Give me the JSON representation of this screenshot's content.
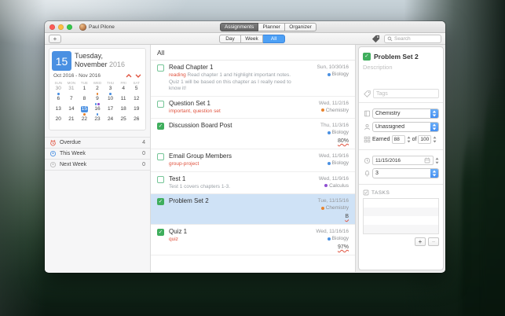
{
  "titlebar": {
    "user": "Paul Pilone",
    "tabs": [
      {
        "label": "Assignments",
        "active": true
      },
      {
        "label": "Planner",
        "active": false
      },
      {
        "label": "Organizer",
        "active": false
      }
    ]
  },
  "toolbar": {
    "add_label": "+",
    "views": [
      "Day",
      "Week",
      "All"
    ],
    "active_view": "All",
    "search_placeholder": "Search"
  },
  "sidebar": {
    "day_number": "15",
    "day_weekday": "Tuesday,",
    "day_month": "November",
    "day_year": "2016",
    "range_label": "Oct 2016 - Nov 2016",
    "weekdays": [
      "SUN",
      "MON",
      "TUE",
      "WED",
      "THU",
      "FRI",
      "SAT"
    ],
    "weeks": [
      [
        {
          "d": "30",
          "muted": true,
          "dots": [
            "#4a90e2"
          ]
        },
        {
          "d": "31",
          "muted": true
        },
        {
          "d": "1"
        },
        {
          "d": "2",
          "dots": [
            "#e8832d"
          ]
        },
        {
          "d": "3",
          "dots": [
            "#4a90e2"
          ]
        },
        {
          "d": "4"
        },
        {
          "d": "5"
        }
      ],
      [
        {
          "d": "6"
        },
        {
          "d": "7"
        },
        {
          "d": "8"
        },
        {
          "d": "9",
          "dots": [
            "#4a90e2",
            "#8f4fd1"
          ]
        },
        {
          "d": "10"
        },
        {
          "d": "11"
        },
        {
          "d": "12"
        }
      ],
      [
        {
          "d": "13"
        },
        {
          "d": "14"
        },
        {
          "d": "15",
          "selected": true,
          "dots": [
            "#e8832d"
          ]
        },
        {
          "d": "16",
          "dots": [
            "#4a90e2"
          ]
        },
        {
          "d": "17"
        },
        {
          "d": "18"
        },
        {
          "d": "19"
        }
      ],
      [
        {
          "d": "20"
        },
        {
          "d": "21"
        },
        {
          "d": "22"
        },
        {
          "d": "23"
        },
        {
          "d": "24"
        },
        {
          "d": "25"
        },
        {
          "d": "26"
        }
      ]
    ],
    "filters": [
      {
        "label": "Overdue",
        "count": "4",
        "icon": "overdue-clock"
      },
      {
        "label": "This Week",
        "count": "0",
        "icon": "this-week-circle"
      },
      {
        "label": "Next Week",
        "count": "0",
        "icon": "next-week-circle"
      }
    ]
  },
  "list": {
    "header": "All",
    "items": [
      {
        "title": "Read Chapter 1",
        "tags": "reading",
        "note": "Read chapter 1 and highlight important notes. Quiz 1 will be based on this chapter as I really need to know it!",
        "date": "Sun, 10/30/16",
        "course": "Biology",
        "checked": false,
        "selected": false
      },
      {
        "title": "Question Set 1",
        "tags": "important, question set",
        "date": "Wed, 11/2/16",
        "course": "Chemistry",
        "checked": false,
        "selected": false
      },
      {
        "title": "Discussion Board Post",
        "date": "Thu, 11/3/16",
        "course": "Biology",
        "checked": true,
        "grade": "80%",
        "selected": false
      },
      {
        "title": "Email Group Members",
        "tags": "group-project",
        "date": "Wed, 11/9/16",
        "course": "Biology",
        "checked": false,
        "selected": false
      },
      {
        "title": "Test 1",
        "note": "Test 1 covers chapters 1-3.",
        "date": "Wed, 11/9/16",
        "course": "Calculus",
        "checked": false,
        "selected": false
      },
      {
        "title": "Problem Set 2",
        "date": "Tue, 11/15/16",
        "course": "Chemistry",
        "checked": true,
        "grade": "B",
        "selected": true
      },
      {
        "title": "Quiz 1",
        "tags": "quiz",
        "date": "Wed, 11/16/16",
        "course": "Biology",
        "checked": true,
        "grade": "97%",
        "selected": false
      }
    ]
  },
  "detail": {
    "title": "Problem Set 2",
    "checked": true,
    "description_placeholder": "Description",
    "tags_placeholder": "Tags",
    "course": "Chemistry",
    "assignee": "Unassigned",
    "earned_label": "Earned",
    "earned": "88",
    "of_label": "of",
    "total": "100",
    "due_date": "11/15/2016",
    "priority": "3",
    "tasks_label": "TASKS",
    "add_label": "+",
    "remove_label": "−"
  },
  "colors": {
    "accent_blue": "#4a90e2",
    "selection_blue": "#cfe2f6",
    "tag_red": "#e0533f",
    "checkbox_green": "#3fae5d",
    "courses": {
      "Biology": "#4a90e2",
      "Chemistry": "#e8832d",
      "Calculus": "#8f4fd1"
    }
  }
}
